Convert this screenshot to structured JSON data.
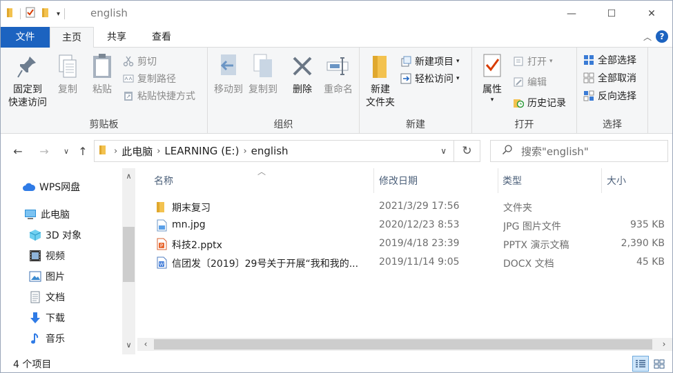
{
  "window": {
    "title": "english",
    "controls": {
      "minimize": "—",
      "maximize": "☐",
      "close": "✕"
    }
  },
  "tabs": [
    {
      "label": "文件"
    },
    {
      "label": "主页"
    },
    {
      "label": "共享"
    },
    {
      "label": "查看"
    }
  ],
  "ribbon": {
    "clipboard": {
      "label": "剪贴板",
      "pin_line1": "固定到",
      "pin_line2": "快速访问",
      "copy": "复制",
      "paste": "粘贴",
      "cut": "剪切",
      "copy_path": "复制路径",
      "paste_shortcut": "粘贴快捷方式"
    },
    "organize": {
      "label": "组织",
      "move_to": "移动到",
      "copy_to": "复制到",
      "delete": "删除",
      "rename": "重命名"
    },
    "new": {
      "label": "新建",
      "new_folder_line1": "新建",
      "new_folder_line2": "文件夹",
      "new_item": "新建项目",
      "easy_access": "轻松访问"
    },
    "open": {
      "label": "打开",
      "properties": "属性",
      "open": "打开",
      "edit": "编辑",
      "history": "历史记录"
    },
    "select": {
      "label": "选择",
      "select_all": "全部选择",
      "select_none": "全部取消",
      "invert": "反向选择"
    }
  },
  "address": {
    "crumbs": [
      "此电脑",
      "LEARNING (E:)",
      "english"
    ],
    "search_placeholder": "搜索\"english\""
  },
  "navpane": {
    "items": [
      {
        "label": "WPS网盘",
        "icon": "cloud-icon"
      },
      {
        "label": "此电脑",
        "icon": "computer-icon"
      },
      {
        "label": "3D 对象",
        "icon": "cube-3d-icon"
      },
      {
        "label": "视频",
        "icon": "video-icon"
      },
      {
        "label": "图片",
        "icon": "picture-icon"
      },
      {
        "label": "文档",
        "icon": "document-icon"
      },
      {
        "label": "下载",
        "icon": "download-icon"
      },
      {
        "label": "音乐",
        "icon": "music-icon"
      }
    ]
  },
  "columns": {
    "name": "名称",
    "date": "修改日期",
    "type": "类型",
    "size": "大小"
  },
  "files": [
    {
      "name": "期末复习",
      "date": "2021/3/29 17:56",
      "type": "文件夹",
      "size": "",
      "icon": "folder-icon"
    },
    {
      "name": "mn.jpg",
      "date": "2020/12/23 8:53",
      "type": "JPG 图片文件",
      "size": "935 KB",
      "icon": "image-file-icon"
    },
    {
      "name": "科技2.pptx",
      "date": "2019/4/18 23:39",
      "type": "PPTX 演示文稿",
      "size": "2,390 KB",
      "icon": "pptx-file-icon"
    },
    {
      "name": "信团发〔2019〕29号关于开展“我和我的...",
      "date": "2019/11/14 9:05",
      "type": "DOCX 文档",
      "size": "45 KB",
      "icon": "docx-file-icon"
    }
  ],
  "status": {
    "count": "4 个项目"
  },
  "colors": {
    "accent": "#1c63c0",
    "folder": "#f3c24f"
  }
}
